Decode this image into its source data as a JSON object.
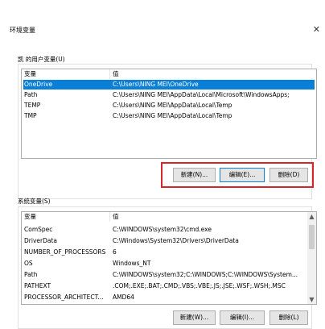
{
  "window": {
    "title": "环境变量"
  },
  "user_vars": {
    "label": "凯 的用户变量(U)",
    "col_variable": "变量",
    "col_value": "值",
    "rows": [
      {
        "name": "OneDrive",
        "value": "C:\\Users\\NING MEI\\OneDrive"
      },
      {
        "name": "Path",
        "value": "C:\\Users\\NING MEI\\AppData\\Local\\Microsoft\\WindowsApps;"
      },
      {
        "name": "TEMP",
        "value": "C:\\Users\\NING MEI\\AppData\\Local\\Temp"
      },
      {
        "name": "TMP",
        "value": "C:\\Users\\NING MEI\\AppData\\Local\\Temp"
      }
    ],
    "buttons": {
      "new": "新建(N)...",
      "edit": "编辑(E)...",
      "delete": "删除(D)"
    }
  },
  "system_vars": {
    "label": "系统变量(S)",
    "col_variable": "变量",
    "col_value": "值",
    "rows": [
      {
        "name": "ComSpec",
        "value": "C:\\WINDOWS\\system32\\cmd.exe"
      },
      {
        "name": "DriverData",
        "value": "C:\\Windows\\System32\\Drivers\\DriverData"
      },
      {
        "name": "NUMBER_OF_PROCESSORS",
        "value": "6"
      },
      {
        "name": "OS",
        "value": "Windows_NT"
      },
      {
        "name": "Path",
        "value": "C:\\WINDOWS\\system32;C:\\WINDOWS;C:\\WINDOWS\\System..."
      },
      {
        "name": "PATHEXT",
        "value": ".COM;.EXE;.BAT;.CMD;.VBS;.VBE;.JS;.JSE;.WSF;.WSH;.MSC"
      },
      {
        "name": "PROCESSOR_ARCHITECT...",
        "value": "AMD64"
      }
    ],
    "buttons": {
      "new": "新建(W)...",
      "edit": "编辑(I)...",
      "delete": "删除(L)"
    }
  },
  "colors": {
    "selection": "#0a7fd8",
    "highlight_box": "#d7262b"
  }
}
